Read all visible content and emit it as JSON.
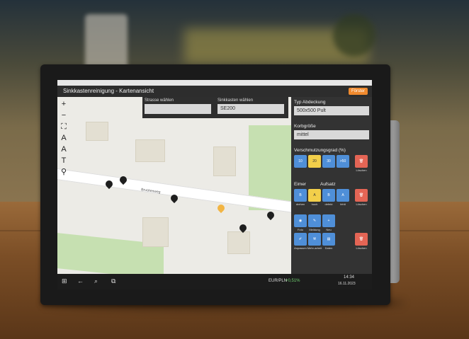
{
  "app": {
    "title": "Sinkkastenreinigung - Kartenansicht",
    "mode_button": "Förster"
  },
  "map": {
    "road_name": "Bruckenweg",
    "tools": [
      {
        "icon": "zoom-in-icon",
        "glyph": "+"
      },
      {
        "icon": "zoom-out-icon",
        "glyph": "−"
      },
      {
        "icon": "fullscreen-icon",
        "glyph": "⛶"
      },
      {
        "icon": "text-size-large-icon",
        "glyph": "A"
      },
      {
        "icon": "text-size-small-icon",
        "glyph": "A"
      },
      {
        "icon": "text-icon",
        "glyph": "T"
      },
      {
        "icon": "location-icon",
        "glyph": "⚲"
      }
    ]
  },
  "selects": {
    "street": {
      "label": "Strasse wählen",
      "value": ""
    },
    "sink": {
      "label": "Sinkkasten wählen",
      "value": "SE200"
    }
  },
  "panel": {
    "cover_type": {
      "label": "Typ Abdeckung",
      "value": "500x500 Pult"
    },
    "basket_size": {
      "label": "Korbgröße",
      "value": "mittel"
    },
    "soiling": {
      "label": "Verschmutzungsgrad (%)",
      "options": [
        "10",
        "20",
        "30",
        ">50"
      ],
      "delete": "Löschen"
    },
    "bucket": {
      "label": "Eimer",
      "label2": "Aufsatz",
      "buttons": [
        {
          "glyph": "B",
          "caption": "drehen"
        },
        {
          "glyph": "A",
          "caption": "hoch"
        },
        {
          "glyph": "B",
          "caption": "defekt"
        },
        {
          "glyph": "A",
          "caption": "fehlt"
        }
      ],
      "delete": "Löschen"
    },
    "actions": [
      {
        "icon": "camera-icon",
        "caption": "Foto"
      },
      {
        "icon": "note-icon",
        "caption": "Meldung"
      },
      {
        "icon": "plus-icon",
        "caption": "Neu"
      },
      {
        "icon": "pencil-icon",
        "caption": "Anpassen"
      },
      {
        "icon": "tools-icon",
        "caption": "Mehr-arbeit"
      },
      {
        "icon": "data-icon",
        "caption": "Daten"
      }
    ],
    "actions_delete": "Löschen"
  },
  "taskbar": {
    "currency": "EUR/PLN",
    "change": "+0,51%",
    "time": "14:34",
    "date": "16.11.2023"
  }
}
